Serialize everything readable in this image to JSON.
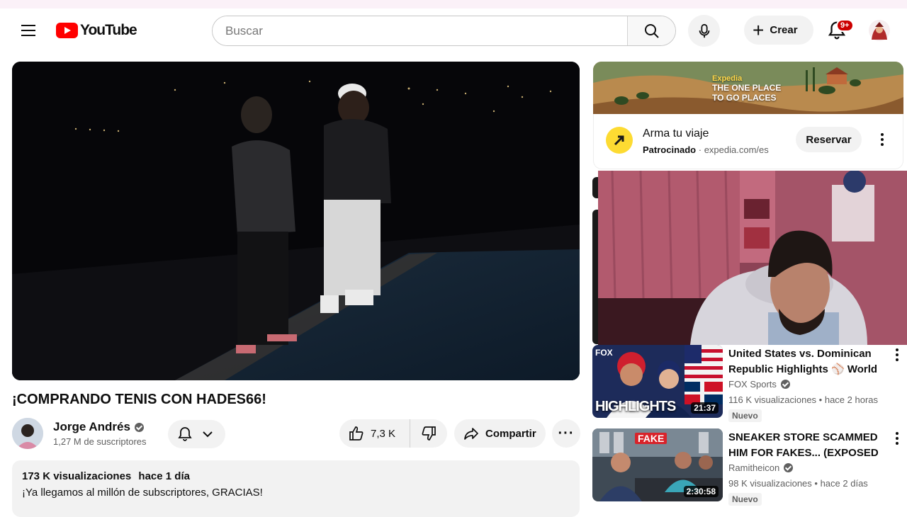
{
  "header": {
    "logo_text": "YouTube",
    "search_placeholder": "Buscar",
    "create_label": "Crear",
    "notif_count": "9+"
  },
  "video": {
    "title": "¡COMPRANDO TENIS CON HADES66!",
    "channel": "Jorge Andrés",
    "subscribers": "1,27 M de suscriptores",
    "likes": "7,3 K",
    "share_label": "Compartir",
    "views": "173 K visualizaciones",
    "age": "hace 1 día",
    "description": "¡Ya llegamos al millón de subscriptores, GRACIAS!"
  },
  "ad": {
    "banner_brand": "Expedia",
    "banner_tagline_1": "THE ONE PLACE",
    "banner_tagline_2": "TO GO PLACES",
    "title": "Arma tu viaje",
    "sponsored": "Patrocinado",
    "domain": "expedia.com/es",
    "cta": "Reservar"
  },
  "related": [
    {
      "title": "United States vs. Dominican Republic Highlights ⚾ World ...",
      "channel": "FOX Sports",
      "views": "116 K visualizaciones",
      "age": "hace 2 horas",
      "badge": "Nuevo",
      "duration": "21:37",
      "thumb_text": "HIGHLIGHTS",
      "thumb_brand": "FOX"
    },
    {
      "title": "SNEAKER STORE SCAMMED HIM FOR FAKES... (EXPOSED I...",
      "channel": "Ramitheicon",
      "views": "98 K visualizaciones",
      "age": "hace 2 días",
      "badge": "Nuevo",
      "duration": "2:30:58",
      "thumb_text": "FAKE"
    }
  ],
  "colors": {
    "brand_red": "#ff0000",
    "badge_red": "#cc0000",
    "pill_bg": "#f2f2f2",
    "secondary_text": "#606060",
    "expedia_yellow": "#fddb32"
  }
}
